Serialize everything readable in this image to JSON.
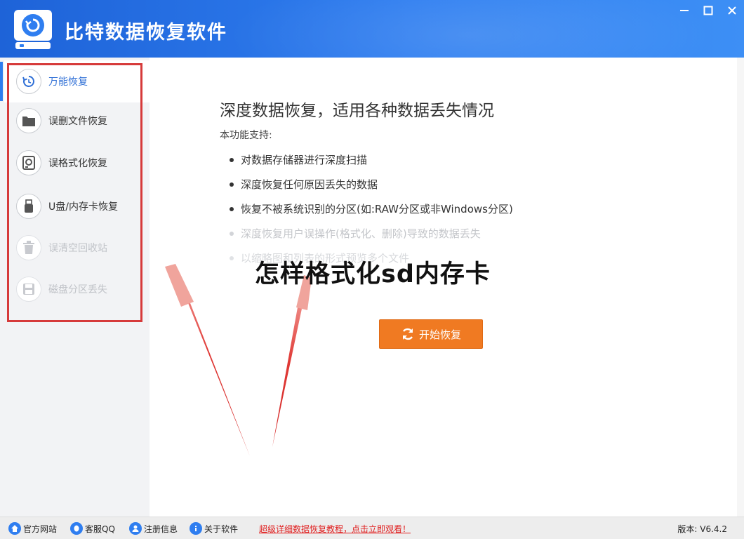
{
  "header": {
    "title": "比特数据恢复软件"
  },
  "window_controls": {
    "minimize": "—",
    "maximize": "☐",
    "close": "✕"
  },
  "sidebar": {
    "items": [
      {
        "label": "万能恢复",
        "icon": "restore-icon",
        "state": "active"
      },
      {
        "label": "误删文件恢复",
        "icon": "folder-icon",
        "state": "normal"
      },
      {
        "label": "误格式化恢复",
        "icon": "disk-icon",
        "state": "normal"
      },
      {
        "label": "U盘/内存卡恢复",
        "icon": "usb-icon",
        "state": "normal"
      },
      {
        "label": "误清空回收站",
        "icon": "trash-icon",
        "state": "faded"
      },
      {
        "label": "磁盘分区丢失",
        "icon": "partition-icon",
        "state": "faded"
      }
    ]
  },
  "main": {
    "title": "深度数据恢复，适用各种数据丢失情况",
    "support_label": "本功能支持:",
    "features": [
      "对数据存储器进行深度扫描",
      "深度恢复任何原因丢失的数据",
      "恢复不被系统识别的分区(如:RAW分区或非Windows分区)",
      "深度恢复用户误操作(格式化、删除)导致的数据丢失",
      "以缩略图和列表的形式预览多个文件"
    ],
    "start_button": "开始恢复"
  },
  "overlay_text": "怎样格式化sd内存卡",
  "footer": {
    "links": [
      {
        "label": "官方网站",
        "icon": "home-icon"
      },
      {
        "label": "客服QQ",
        "icon": "qq-icon"
      },
      {
        "label": "注册信息",
        "icon": "user-icon"
      },
      {
        "label": "关于软件",
        "icon": "info-icon"
      }
    ],
    "promo": "超级详细数据恢复教程，点击立即观看！",
    "version": "版本: V6.4.2"
  },
  "colors": {
    "header": "#2f7ef0",
    "accent_orange": "#f07a22",
    "highlight_red": "#d63a3a",
    "link_red": "#e02020"
  }
}
